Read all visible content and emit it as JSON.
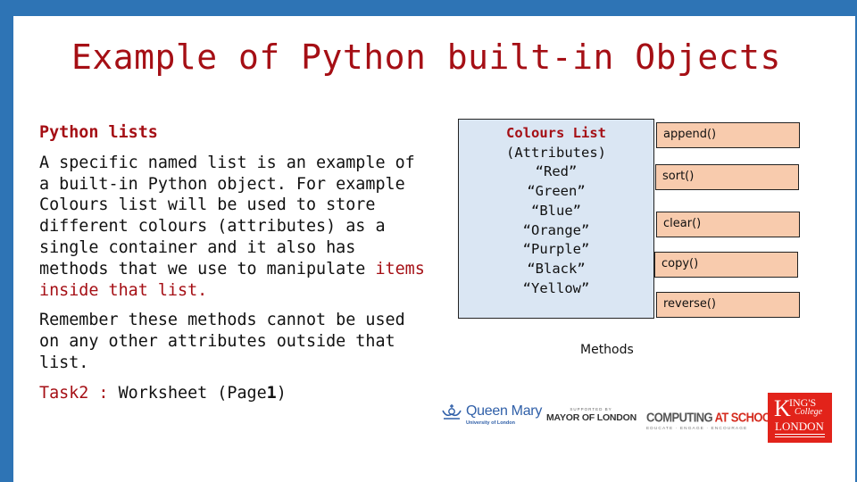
{
  "slide": {
    "title": "Example of Python built-in Objects",
    "accent_color": "#a50f15",
    "frame_color": "#2e74b5"
  },
  "left": {
    "subheading": "Python lists",
    "paragraph1_a": "A specific named list is an example of a built-in Python object. For example Colours list will be used to store different colours (attributes)  as a single container and it also has methods that we use to manipulate ",
    "paragraph1_highlight": "items inside that list.",
    "paragraph2": "Remember these methods cannot be used on any other attributes outside that list.",
    "task_label": "Task2 :",
    "task_text": " Worksheet (Page",
    "task_page": "1",
    "task_close": ")"
  },
  "colours_list": {
    "title": "Colours List",
    "subtitle": "(Attributes)",
    "items": [
      "“Red”",
      "“Green”",
      "“Blue”",
      "“Orange”",
      "“Purple”",
      "“Black”",
      "“Yellow”"
    ],
    "fill_color": "#dae6f3"
  },
  "methods": {
    "label": "Methods",
    "fill_color": "#f8cbad",
    "items": [
      "append()",
      "sort()",
      "clear()",
      "copy()",
      "reverse()"
    ]
  },
  "logos": {
    "queen_mary": {
      "name": "Queen Mary",
      "sub": "University of London"
    },
    "mayor": {
      "supported": "SUPPORTED BY",
      "name": "MAYOR OF LONDON"
    },
    "cas": {
      "name_a": "COMPUTING ",
      "name_b": "AT SCHOOL",
      "tagline": "EDUCATE · ENGAGE · ENCOURAGE"
    },
    "kcl": {
      "k": "K",
      "ings": "ING'S",
      "college": "College",
      "london": "LONDON"
    }
  }
}
